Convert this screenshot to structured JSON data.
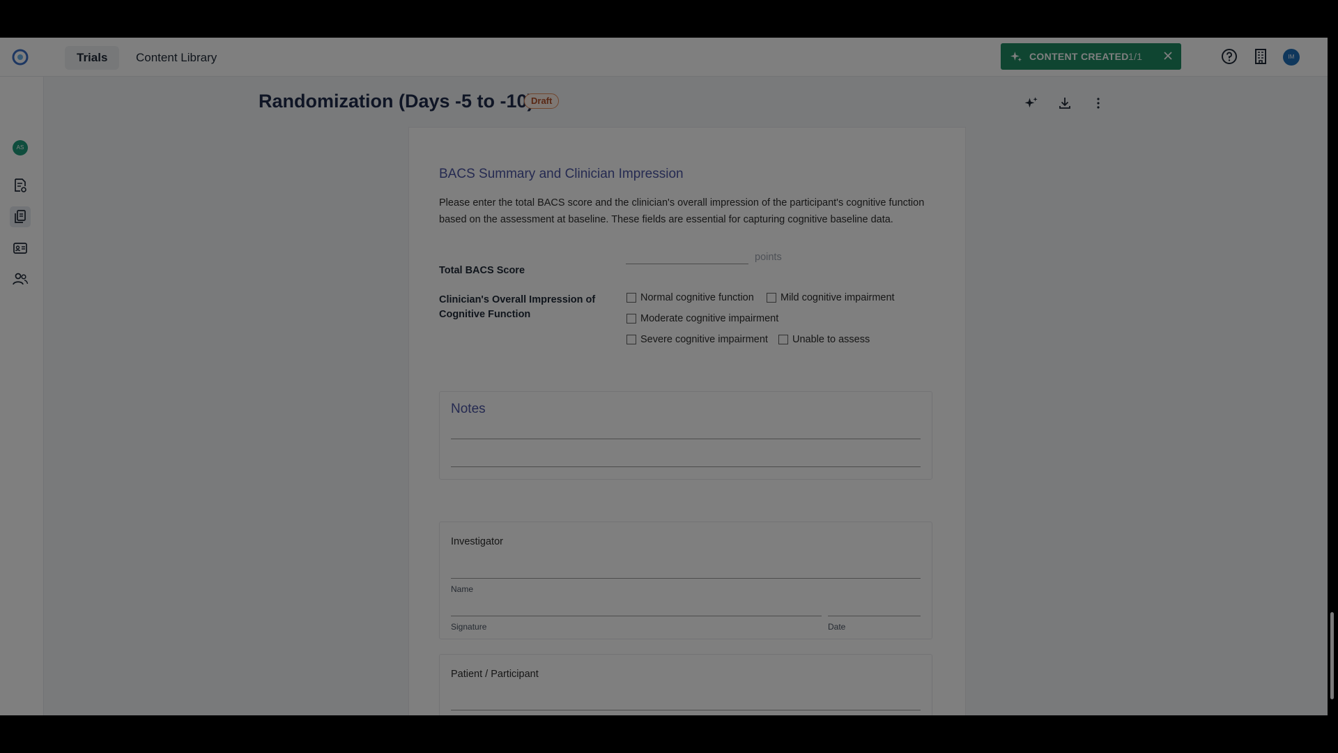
{
  "nav": {
    "tabs": [
      {
        "label": "Trials"
      },
      {
        "label": "Content Library"
      }
    ]
  },
  "banner": {
    "label": "CONTENT CREATED",
    "count": "1/1"
  },
  "user": {
    "initials": "IM"
  },
  "sidebar": {
    "avatar_initials": "AS"
  },
  "page": {
    "title": "Randomization (Days -5 to -10)",
    "status": "Draft"
  },
  "form": {
    "section_title": "BACS Summary and Clinician Impression",
    "description": "Please enter the total BACS score and the clinician's overall impression of the participant's cognitive function based on the assessment at baseline. These fields are essential for capturing cognitive baseline data.",
    "total_score": {
      "label": "Total BACS Score",
      "value": "",
      "unit": "points"
    },
    "impression": {
      "label": "Clinician's Overall Impression of Cognitive Function",
      "options": [
        "Normal cognitive function",
        "Mild cognitive impairment",
        "Moderate cognitive impairment",
        "Severe cognitive impairment",
        "Unable to assess"
      ]
    },
    "notes": {
      "title": "Notes"
    },
    "investigator": {
      "title": "Investigator",
      "name_label": "Name",
      "signature_label": "Signature",
      "date_label": "Date"
    },
    "participant": {
      "title": "Patient / Participant"
    }
  },
  "colors": {
    "banner_bg": "#1f8a62",
    "section_title": "#4a55a2",
    "draft_border": "#e08a5b",
    "page_title": "#1e2a4a"
  }
}
